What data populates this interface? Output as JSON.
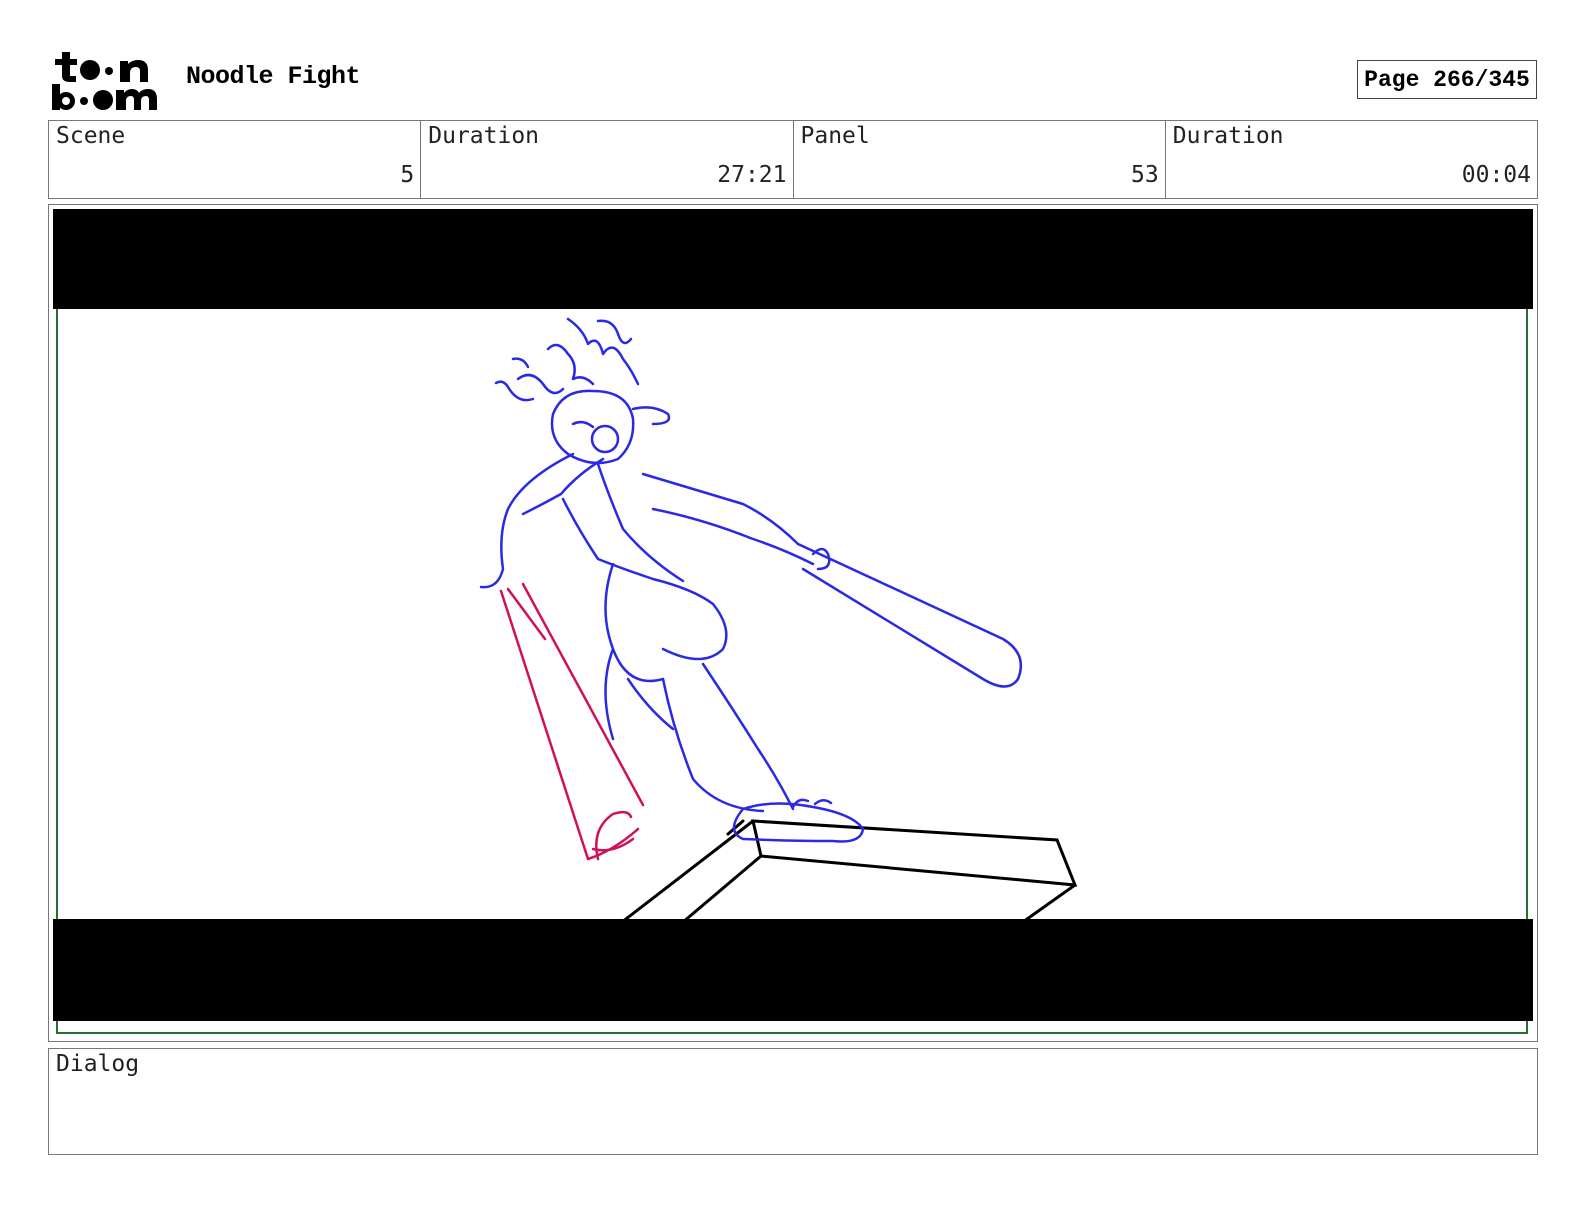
{
  "header": {
    "logo_icon": "toonboom-logo",
    "logo_text": [
      "toon",
      "boom"
    ],
    "project_title": "Noodle Fight",
    "page_label": "Page 266/345"
  },
  "info": {
    "scene_label": "Scene",
    "scene_value": "5",
    "scene_duration_label": "Duration",
    "scene_duration_value": "27:21",
    "panel_label": "Panel",
    "panel_value": "53",
    "panel_duration_label": "Duration",
    "panel_duration_value": "00:04"
  },
  "panel": {
    "image": "storyboard-sketch",
    "safe_frame_color": "#2e6b2e",
    "letterbox_color": "#000000",
    "sketch_colors": {
      "character": "#2a2ae6",
      "bat": "#d0105a",
      "table": "#000000"
    }
  },
  "dialog": {
    "label": "Dialog",
    "text": ""
  }
}
